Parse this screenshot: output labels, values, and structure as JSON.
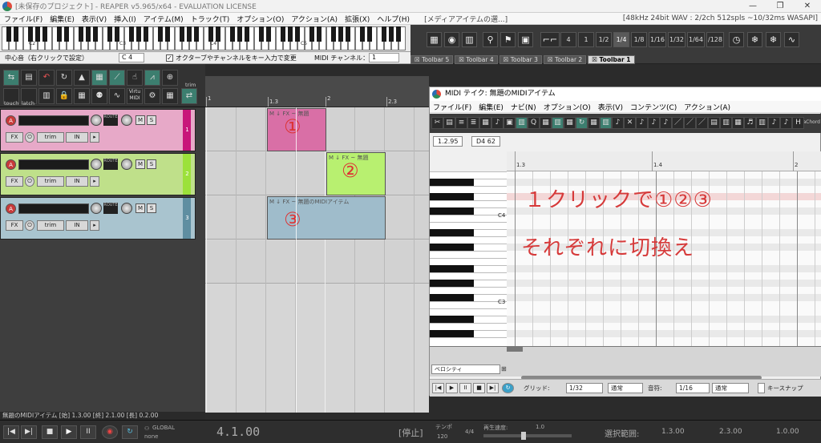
{
  "window": {
    "title": "[未保存のプロジェクト] - REAPER v5.965/x64 - EVALUATION LICENSE",
    "controls": [
      "—",
      "❐",
      "✕"
    ]
  },
  "menubar": {
    "items": [
      "ファイル(F)",
      "編集(E)",
      "表示(V)",
      "挿入(I)",
      "アイテム(M)",
      "トラック(T)",
      "オプション(O)",
      "アクション(A)",
      "拡張(X)",
      "ヘルプ(H)"
    ],
    "media_title": "[メディアアイテムの選...]",
    "audio_info": "[48kHz 24bit WAV : 2/2ch 512spls ~10/32ms WASAPI]"
  },
  "keyboard": {
    "octave_labels": [
      "C2",
      "C3",
      "C4",
      "C5"
    ],
    "center_label": "中心音（右クリックで設定）",
    "center_value": "C 4",
    "option_checked": true,
    "option_label": "オクターブやチャンネルをキー入力で変更",
    "channel_label": "MIDI チャンネル：",
    "channel_value": "1"
  },
  "toolbar": {
    "grid_buttons": [
      "1",
      "1/2",
      "1/4",
      "1/8",
      "1/16",
      "1/32",
      "1/64",
      "/128"
    ],
    "first_button": "4",
    "active_grid": "1/4",
    "tabs": [
      "Toolbar 5",
      "Toolbar 4",
      "Toolbar 3",
      "Toolbar 2",
      "Toolbar 1"
    ],
    "active_tab": "Toolbar 1",
    "tab_prefix": "☒"
  },
  "left_toolbar": {
    "captions": [
      "trim",
      "touch",
      "latch",
      "Virtu MIDI"
    ]
  },
  "tracks": [
    {
      "number": "1",
      "color": "#e7a9c8",
      "strip": "#c8167a",
      "rec": "A",
      "mute": "M",
      "solo": "S",
      "fx": "FX",
      "in": "IN",
      "trim": "trim",
      "route": "ROUTE"
    },
    {
      "number": "2",
      "color": "#bfe08a",
      "strip": "#9ce13a",
      "rec": "A",
      "mute": "M",
      "solo": "S",
      "fx": "FX",
      "in": "IN",
      "trim": "trim",
      "route": "ROUTE"
    },
    {
      "number": "3",
      "color": "#a9c4cf",
      "strip": "#5f8ea1",
      "rec": "A",
      "mute": "M",
      "solo": "S",
      "fx": "FX",
      "in": "IN",
      "trim": "trim",
      "route": "ROUTE"
    }
  ],
  "arrange": {
    "ruler_labels": [
      "1",
      "1.3",
      "2",
      "2.3"
    ],
    "items": [
      {
        "header": "M  ↓  FX  ~  無題",
        "circle": "①",
        "color": "#d96fa6"
      },
      {
        "header": "M  ↓  FX  ~  無題",
        "circle": "②",
        "color": "#b8f070"
      },
      {
        "header": "M  ↓  FX  ~  無題のMIDIアイテム",
        "circle": "③",
        "color": "#9fbccb"
      }
    ]
  },
  "midi_editor": {
    "title": "MIDI テイク: 無題のMIDIアイテム",
    "menu": [
      "ファイル(F)",
      "編集(E)",
      "ナビ(N)",
      "オプション(O)",
      "表示(V)",
      "コンテンツ(C)",
      "アクション(A)"
    ],
    "toolbar_end": "ReaChord",
    "position": "1.2.95",
    "note": "D4  62",
    "ruler_labels": [
      "1.3",
      "1.4",
      "2"
    ],
    "note_labels": [
      "C4",
      "C3"
    ],
    "annotation_line1": "１クリックで①②③",
    "annotation_line2": "それぞれに切換え",
    "cc_lane": "ベロシティ",
    "footer": {
      "grid_label": "グリッド:",
      "grid_value": "1/32",
      "grid_type": "通常",
      "note_label": "音符:",
      "note_value": "1/16",
      "note_type": "通常",
      "keysnap_label": "キースナップ"
    }
  },
  "status": {
    "item_info": "無題のMIDIアイテム [始] 1.3.00 [終] 2.1.00 [長] 0.2.00"
  },
  "transport": {
    "global_label": "GLOBAL",
    "none_label": "none",
    "position": "4.1.00",
    "state": "[停止]",
    "tempo_label": "テンポ",
    "tempo_value": "120",
    "timesig": "4/4",
    "rate_label": "再生速度:",
    "rate_value": "1.0",
    "selection_label": "選択範囲:",
    "sel_start": "1.3.00",
    "sel_end": "2.3.00",
    "sel_len": "1.0.00"
  }
}
